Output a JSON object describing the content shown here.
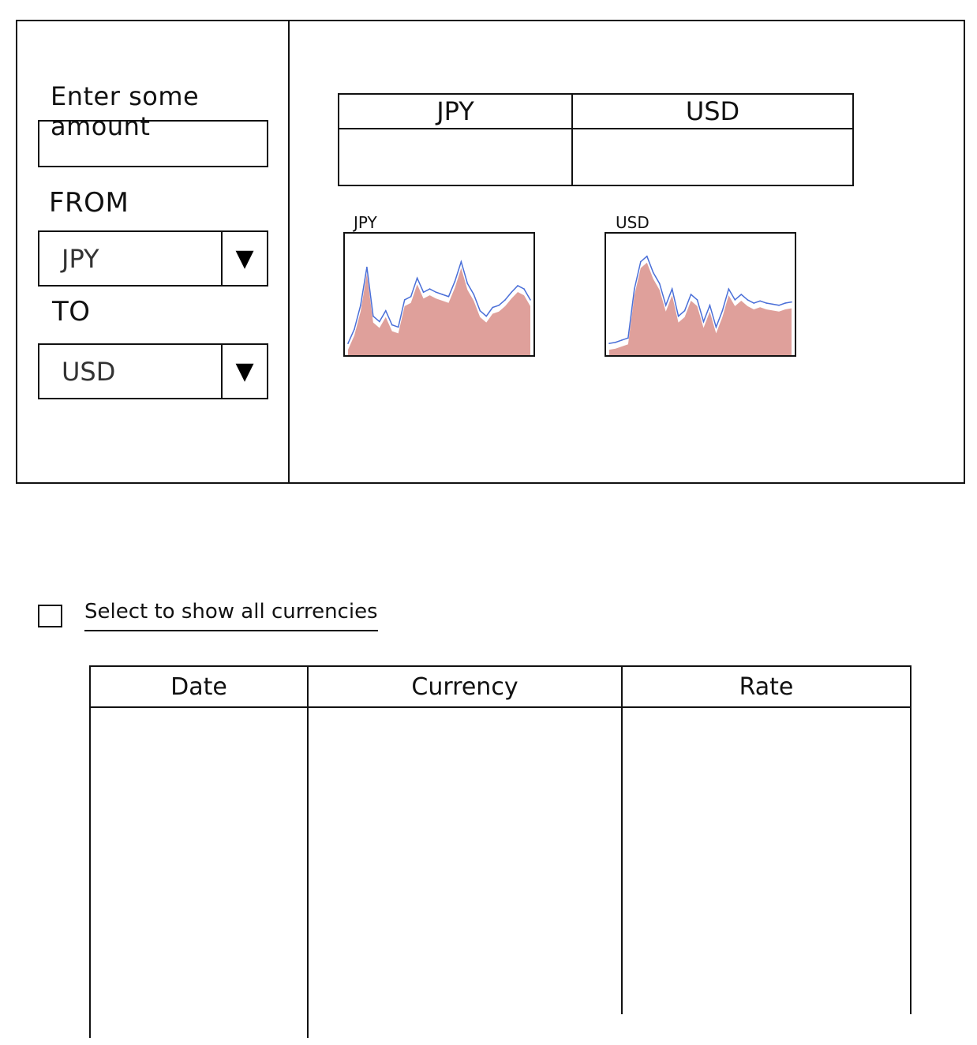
{
  "converter": {
    "amount_label": "Enter some amount",
    "amount_value": "",
    "from_label": "FROM",
    "from_value": "JPY",
    "to_label": "TO",
    "to_value": "USD",
    "dropdown_arrow": "▼"
  },
  "result_table": {
    "columns": [
      "JPY",
      "USD"
    ],
    "values": [
      "",
      ""
    ]
  },
  "charts": [
    {
      "title": "JPY",
      "chart_data": {
        "type": "area",
        "x": [
          0,
          1,
          2,
          3,
          4,
          5,
          6,
          7,
          8,
          9,
          10,
          11,
          12,
          13,
          14,
          15,
          16,
          17,
          18,
          19,
          20,
          21,
          22,
          23,
          24,
          25,
          26,
          27,
          28,
          29
        ],
        "values": [
          5,
          18,
          40,
          75,
          30,
          25,
          35,
          22,
          20,
          45,
          48,
          65,
          52,
          55,
          52,
          50,
          48,
          62,
          80,
          60,
          50,
          35,
          30,
          38,
          40,
          45,
          52,
          58,
          55,
          45
        ],
        "ylim": [
          0,
          100
        ],
        "color_line": "#4a6fd8",
        "color_fill": "#d98f8a",
        "grid": false
      }
    },
    {
      "title": "USD",
      "chart_data": {
        "type": "area",
        "x": [
          0,
          1,
          2,
          3,
          4,
          5,
          6,
          7,
          8,
          9,
          10,
          11,
          12,
          13,
          14,
          15,
          16,
          17,
          18,
          19,
          20,
          21,
          22,
          23,
          24,
          25,
          26,
          27,
          28,
          29
        ],
        "values": [
          5,
          6,
          8,
          10,
          55,
          80,
          85,
          70,
          60,
          40,
          55,
          30,
          35,
          50,
          45,
          25,
          40,
          20,
          35,
          55,
          45,
          50,
          45,
          42,
          44,
          42,
          41,
          40,
          42,
          43
        ],
        "ylim": [
          0,
          100
        ],
        "color_line": "#4a6fd8",
        "color_fill": "#d98f8a",
        "grid": false
      }
    }
  ],
  "toggle": {
    "label": "Select to show all currencies",
    "checked": false
  },
  "history_table": {
    "columns": [
      "Date",
      "Currency",
      "Rate"
    ],
    "rows": []
  }
}
